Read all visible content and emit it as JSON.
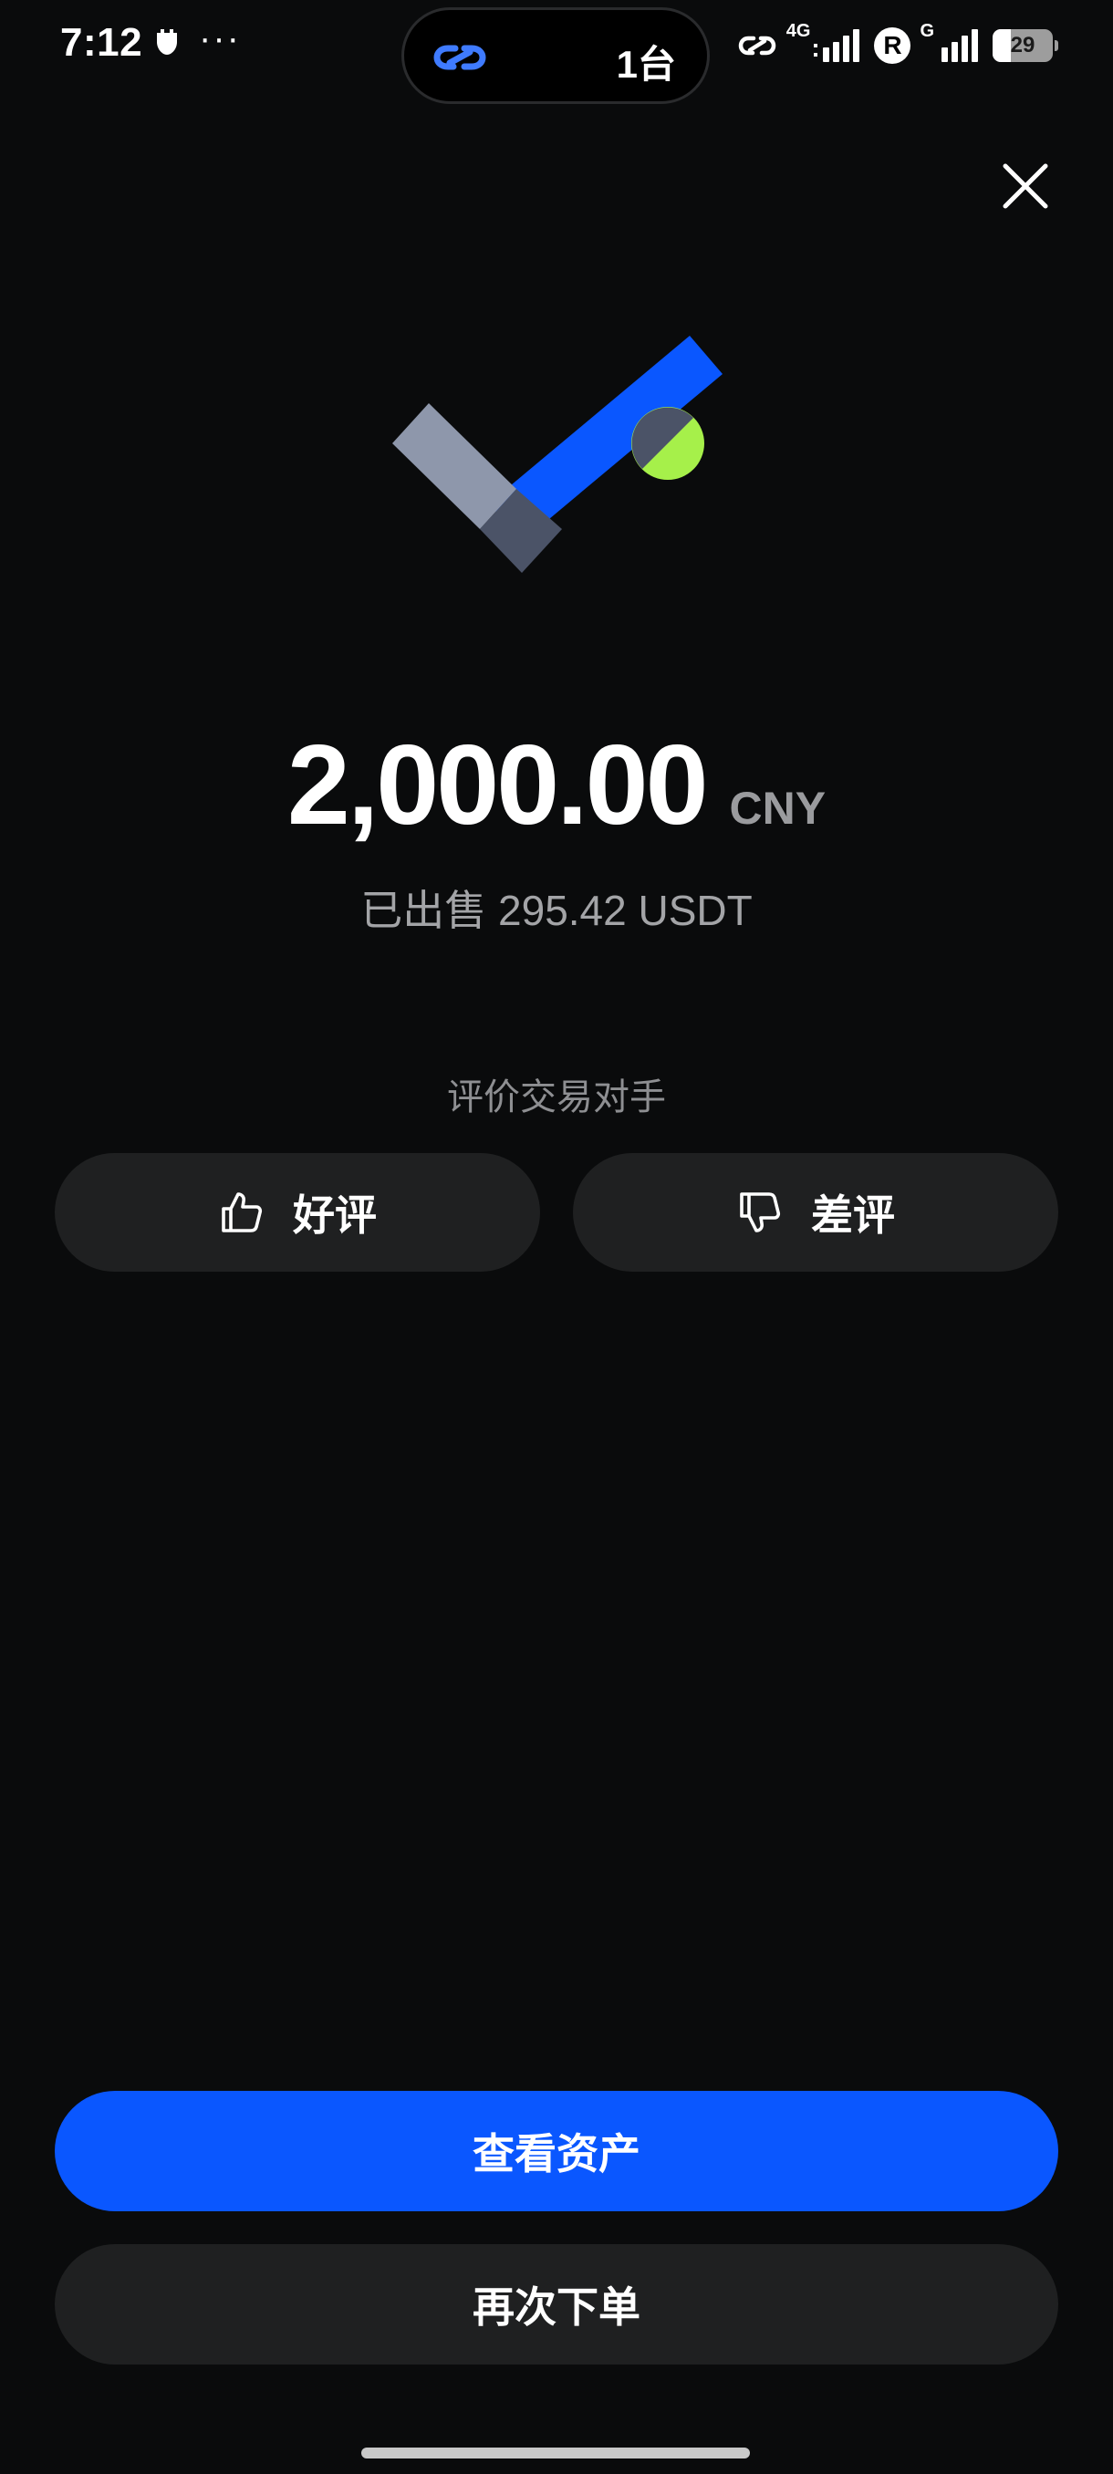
{
  "status_bar": {
    "time": "7:12",
    "more": "···",
    "island_text": "1台",
    "network_4g": "4G",
    "network_g": "G",
    "r_badge": "R",
    "battery": "29"
  },
  "result": {
    "amount": "2,000.00",
    "currency": "CNY",
    "sold_text": "已出售 295.42 USDT"
  },
  "rating": {
    "title": "评价交易对手",
    "good_label": "好评",
    "bad_label": "差评"
  },
  "actions": {
    "view_assets_label": "查看资产",
    "reorder_label": "再次下单"
  },
  "colors": {
    "background": "#0a0b0c",
    "primary_button": "#0a57ff",
    "secondary_button": "#1f2021",
    "check_blue": "#0a57ff",
    "check_gray": "#8e97ab",
    "check_lime": "#a6f04a"
  }
}
